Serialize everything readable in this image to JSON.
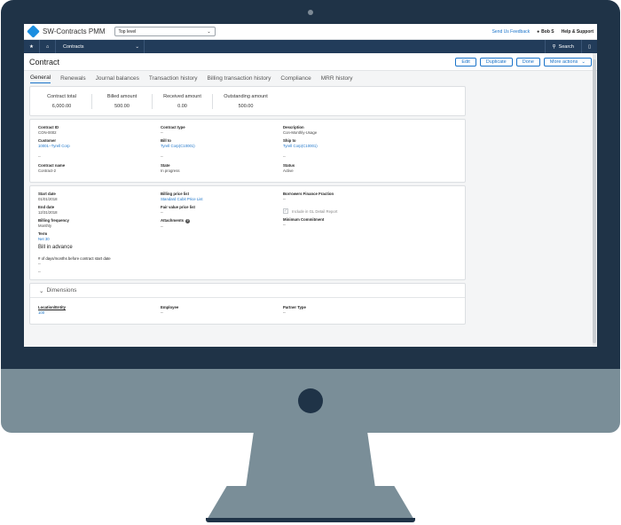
{
  "app": {
    "title": "SW-Contracts PMM",
    "level_select": "Top level",
    "feedback": "Send Us Feedback",
    "user": "Bob S",
    "help": "Help & Support"
  },
  "nav": {
    "menu_label": "Contracts",
    "search_label": "Search"
  },
  "page": {
    "title": "Contract",
    "actions": {
      "edit": "Edit",
      "duplicate": "Duplicate",
      "done": "Done",
      "more": "More actions"
    }
  },
  "tabs": [
    "General",
    "Renewals",
    "Journal balances",
    "Transaction history",
    "Billing transaction history",
    "Compliance",
    "MRR history"
  ],
  "summary": [
    {
      "label": "Contract total",
      "value": "6,000.00"
    },
    {
      "label": "Billed amount",
      "value": "500.00"
    },
    {
      "label": "Received amount",
      "value": "0.00"
    },
    {
      "label": "Outstanding amount",
      "value": "500.00"
    }
  ],
  "details": {
    "contract_id_label": "Contract ID",
    "contract_id": "CON-0002",
    "contract_type_label": "Contract type",
    "contract_type": "--",
    "description_label": "Description",
    "description": "Con-Monthly-Usage",
    "customer_label": "Customer",
    "customer": "10001--Tyrell Corp",
    "bill_to_label": "Bill to",
    "bill_to": "Tyrell Corp(C10001)",
    "ship_to_label": "Ship to",
    "ship_to": "Tyrell Corp(C10001)",
    "dash": "--",
    "contract_name_label": "Contract name",
    "contract_name": "Contract-2",
    "state_label": "State",
    "state": "In progress",
    "status_label": "Status",
    "status": "Active"
  },
  "billing": {
    "start_date_label": "Start date",
    "start_date": "01/01/2018",
    "end_date_label": "End date",
    "end_date": "12/31/2018",
    "billing_frequency_label": "Billing frequency",
    "billing_frequency": "Monthly",
    "term_label": "Term",
    "term": "Net 30",
    "bill_in_advance": "Bill in advance",
    "days_before_label": "# of days/months before contract start date",
    "dash": "--",
    "price_list_label": "Billing price list",
    "price_list": "Standard Cubit Price List",
    "fair_value_label": "Fair value price list",
    "fair_value": "--",
    "attachments_label": "Attachments",
    "attachments": "--",
    "borrowers_label": "Borrowers Finance Fraction",
    "borrowers": "--",
    "gl_detail": "Include in GL Detail Report",
    "min_commit_label": "Minimum Commitment",
    "min_commit": "--"
  },
  "dimensions": {
    "title": "Dimensions",
    "location_label": "Location/Entity",
    "location": "100",
    "employee_label": "Employee",
    "employee": "--",
    "partner_label": "Partner Type",
    "partner": "--"
  }
}
